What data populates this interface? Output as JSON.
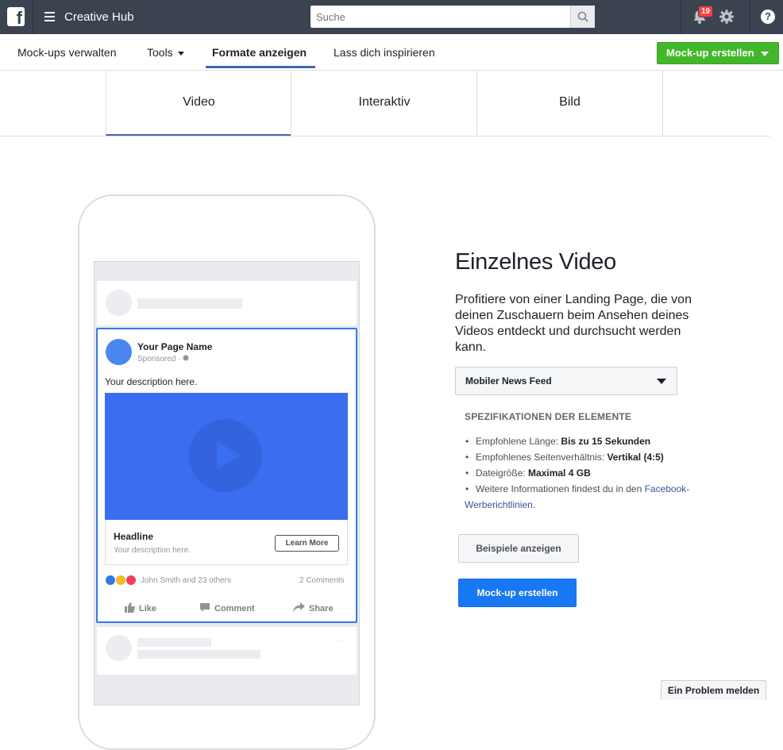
{
  "topbar": {
    "app_title": "Creative Hub",
    "search_placeholder": "Suche",
    "notification_count": "19",
    "logo_letter": "f",
    "help_label": "?",
    "bar_color": "#3b4350"
  },
  "subnav": {
    "items": [
      {
        "label": "Mock-ups verwalten"
      },
      {
        "label": "Tools"
      },
      {
        "label": "Formate anzeigen"
      },
      {
        "label": "Lass dich inspirieren"
      }
    ],
    "active_index": 2,
    "create_button": "Mock-up erstellen",
    "create_color": "#42b72a"
  },
  "format_tabs": {
    "tabs": [
      "Video",
      "Interaktiv",
      "Bild"
    ],
    "active_index": 0
  },
  "mockup": {
    "page_name": "Your Page Name",
    "sponsored": "Sponsored · ",
    "description": "Your description here.",
    "headline": "Headline",
    "link_description": "Your description here.",
    "cta": "Learn More",
    "reaction_text": "John Smith and 23 others",
    "comments": "2 Comments",
    "actions": [
      "Like",
      "Comment",
      "Share"
    ],
    "video_color": "#3b6df1",
    "highlight_color": "#3578e5"
  },
  "details": {
    "title": "Einzelnes Video",
    "lead": "Profitiere von einer Landing Page, die von deinen Zuschauern beim Ansehen deines Videos entdeckt und durchsucht werden kann.",
    "placement": "Mobiler News Feed",
    "spec_heading": "SPEZIFIKATIONEN DER ELEMENTE",
    "specs": [
      {
        "label": "Empfohlene Länge: ",
        "value": "Bis zu 15 Sekunden"
      },
      {
        "label": "Empfohlenes Seitenverhältnis: ",
        "value": "Vertikal (4:5)"
      },
      {
        "label": "Dateigröße: ",
        "value": "Maximal 4 GB"
      }
    ],
    "more_info_text": "Weitere Informationen findest du in den ",
    "more_info_link": "Facebook-Werberichtlinien",
    "more_info_end": ".",
    "examples_button": "Beispiele anzeigen",
    "mockup_button": "Mock-up erstellen",
    "primary_color": "#1877f2"
  },
  "footer": {
    "report_button": "Ein Problem melden"
  }
}
